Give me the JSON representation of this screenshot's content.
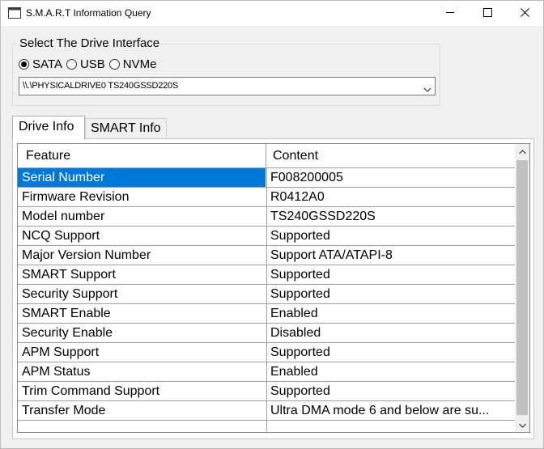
{
  "window": {
    "title": "S.M.A.R.T Information Query"
  },
  "drive_interface": {
    "legend": "Select The Drive Interface",
    "options": [
      {
        "label": "SATA",
        "selected": true
      },
      {
        "label": "USB",
        "selected": false
      },
      {
        "label": "NVMe",
        "selected": false
      }
    ],
    "drive_selected": "\\\\.\\PHYSICALDRIVE0 TS240GSSD220S"
  },
  "tabs": [
    {
      "label": "Drive Info",
      "active": true
    },
    {
      "label": "SMART Info",
      "active": false
    }
  ],
  "grid": {
    "columns": [
      "Feature",
      "Content"
    ],
    "selected_row": 0,
    "rows": [
      {
        "feature": "Serial Number",
        "content": "F008200005"
      },
      {
        "feature": "Firmware Revision",
        "content": "R0412A0"
      },
      {
        "feature": "Model number",
        "content": "TS240GSSD220S"
      },
      {
        "feature": "NCQ Support",
        "content": "Supported"
      },
      {
        "feature": "Major Version Number",
        "content": "Support ATA/ATAPI-8"
      },
      {
        "feature": "SMART Support",
        "content": "Supported"
      },
      {
        "feature": "Security Support",
        "content": "Supported"
      },
      {
        "feature": "SMART Enable",
        "content": "Enabled"
      },
      {
        "feature": "Security Enable",
        "content": "Disabled"
      },
      {
        "feature": "APM Support",
        "content": "Supported"
      },
      {
        "feature": "APM Status",
        "content": "Enabled"
      },
      {
        "feature": "Trim Command Support",
        "content": "Supported"
      },
      {
        "feature": "Transfer Mode",
        "content": "Ultra DMA mode 6 and below are su..."
      }
    ]
  },
  "colors": {
    "selection": "#0078d7",
    "window_bg": "#f0f0f0"
  }
}
